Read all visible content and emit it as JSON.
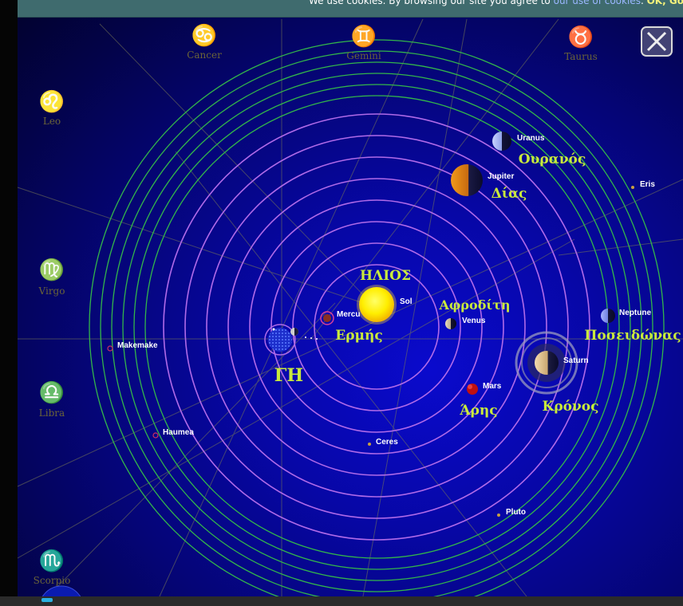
{
  "cookie_bar": {
    "text": "We use cookies. By browsing our site you agree to",
    "link": "our use of cookies",
    "period": ".",
    "ok": "OK, Got I"
  },
  "close_icon": "close-x-icon",
  "zodiac": [
    {
      "glyph": "♋",
      "name": "Cancer"
    },
    {
      "glyph": "♊",
      "name": "Gemini"
    },
    {
      "glyph": "♉",
      "name": "Taurus"
    },
    {
      "glyph": "♌",
      "name": "Leo"
    },
    {
      "glyph": "♍",
      "name": "Virgo"
    },
    {
      "glyph": "♎",
      "name": "Libra"
    },
    {
      "glyph": "♏",
      "name": "Scorpio"
    }
  ],
  "sun": {
    "greek": "ΗΛΙΟΣ",
    "label": "Sol"
  },
  "earth": {
    "greek": "ΓΗ"
  },
  "planets": [
    {
      "label": "Mercu",
      "greek": "Ερμής"
    },
    {
      "label": "Venus",
      "greek": "Αφροδίτη"
    },
    {
      "label": "Mars",
      "greek": "Άρης"
    },
    {
      "label": "Jupiter",
      "greek": "Δίας"
    },
    {
      "label": "Saturn",
      "greek": "Κρόνος"
    },
    {
      "label": "Uranus",
      "greek": "Ουρανός"
    },
    {
      "label": "Neptune",
      "greek": "Ποσειδώνας"
    }
  ],
  "small_bodies": [
    "Ceres",
    "Pluto",
    "Eris",
    "Makemake",
    "Haumea"
  ],
  "colors": {
    "orbit_inner": "#b06ae8",
    "orbit_outer": "#33b64a",
    "greek_text": "#c9ea3c",
    "zodiac_text": "#6b6438",
    "background": "#0707a6"
  }
}
